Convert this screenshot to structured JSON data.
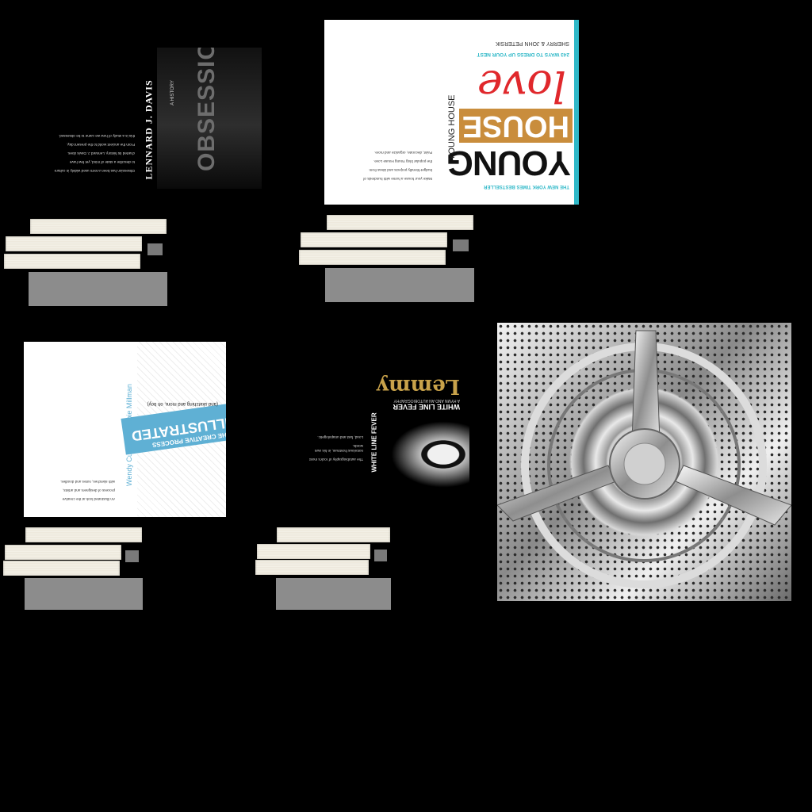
{
  "book1": {
    "author": "LENNARD J. DAVIS",
    "title": "OBSESSION",
    "subtitle": "A HISTORY",
    "blurb_lines": [
      "Obsession has been a term used widely in culture",
      "to describe a state of mind, yet few have",
      "charted its history. Lennard J. Davis does.",
      "From the ancient world to the present day,",
      "this is a study of how we came to be obsessed."
    ]
  },
  "book2": {
    "spine": "YOUNG HOUSE",
    "title_top": "YOUNG",
    "title_mid": "HOUSE",
    "title_script": "love",
    "tagline": "THE NEW YORK TIMES BESTSELLER",
    "authors": "SHERRY & JOHN PETERSIK",
    "sub": "243 WAYS TO DRESS UP YOUR NEST",
    "blurb_lines": [
      "Make your house a home with hundreds of",
      "budget-friendly projects and ideas from",
      "the popular blog Young House Love.",
      "Paint, decorate, organize and more."
    ]
  },
  "book3": {
    "spine": "Wendy Cullen & Debbie Millman",
    "title": "ILLUSTRATED",
    "title_pre": "THE CREATIVE PROCESS",
    "subtitle": "(and sketching and more, oh boy)",
    "blurb_lines": [
      "An illustrated look at the creative",
      "process of designers and artists,",
      "with sketches, notes and doodles."
    ]
  },
  "book4": {
    "spine": "WHITE LINE FEVER",
    "title": "Lemmy",
    "subtitle": "WHITE LINE FEVER",
    "subtitle2": "A HYMN AND AN AUTOBIOGRAPHY",
    "blurb_lines": [
      "The autobiography of rock's most",
      "notorious frontman, in his own words.",
      "Loud, fast and unapologetic."
    ]
  },
  "colors": {
    "background": "#000000",
    "young_house_blue": "#2fb8c8",
    "illustrated_blue": "#5fb0d4",
    "love_red": "#e0282c",
    "lemmy_gold": "#c8a24a"
  }
}
